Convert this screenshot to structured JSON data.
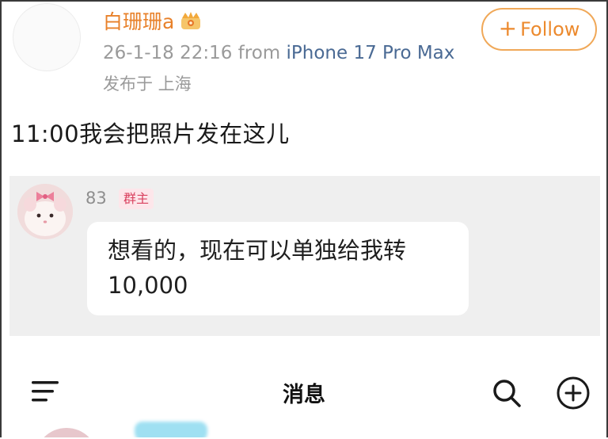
{
  "post": {
    "username": "白珊珊a",
    "timestamp": "26-1-18 22:16",
    "from_label": "from",
    "device": "iPhone 17 Pro Max",
    "location": "发布于 上海",
    "follow_label": "Follow",
    "text": "11:00我会把照片发在这儿"
  },
  "chat": {
    "sender_name": "83",
    "badge": "群主",
    "message_line1": "想看的，现在可以单独给我转",
    "message_line2": "10,000"
  },
  "navbar": {
    "title": "消息",
    "icons": [
      "menu-icon",
      "search-icon",
      "add-circle-icon"
    ]
  },
  "colors": {
    "username": "#e8812a",
    "follow_border": "#f0a858",
    "device_link": "#4a6a94",
    "badge_text": "#d9415f",
    "chat_background": "#efefef"
  }
}
